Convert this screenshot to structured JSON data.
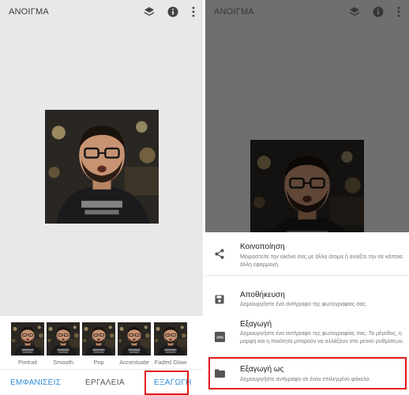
{
  "left": {
    "title": "ΑΝΟΙΓΜΑ",
    "presets": [
      "Portrait",
      "Smooth",
      "Pop",
      "Accentuate",
      "Faded Glow"
    ],
    "tabs": [
      "ΕΜΦΑΝΙΣΕΙΣ",
      "ΕΡΓΑΛΕΙΑ",
      "ΕΞΑΓΩΓΗ"
    ]
  },
  "right": {
    "title": "ΑΝΟΙΓΜΑ",
    "sheet": [
      {
        "title": "Κοινοποίηση",
        "desc": "Μοιραστείτε την εικόνα σας με άλλα άτομα ή ανοίξτε την σε κάποια άλλη εφαρμογή.",
        "icon": "share-icon"
      },
      {
        "title": "Αποθήκευση",
        "desc": "Δημιουργήστε ένα αντίγραφο της φωτογραφίας σας.",
        "icon": "save-icon"
      },
      {
        "title": "Εξαγωγή",
        "desc": "Δημιουργήστε ένα αντίγραφο της φωτογραφίας σας. Το μέγεθος, η μορφή και η ποιότητα μπορούν να αλλάξουν στο μενού ρυθμίσεων.",
        "icon": "jpg-icon",
        "icon_text": "JPG"
      },
      {
        "title": "Εξαγωγή ως",
        "desc": "Δημιουργήστε αντίγραφο σε έναν επιλεγμένο φάκελο.",
        "icon": "folder-icon"
      }
    ]
  },
  "colors": {
    "accent": "#2e8ad8",
    "highlight": "#e01818",
    "tab_inactive": "#555555"
  }
}
